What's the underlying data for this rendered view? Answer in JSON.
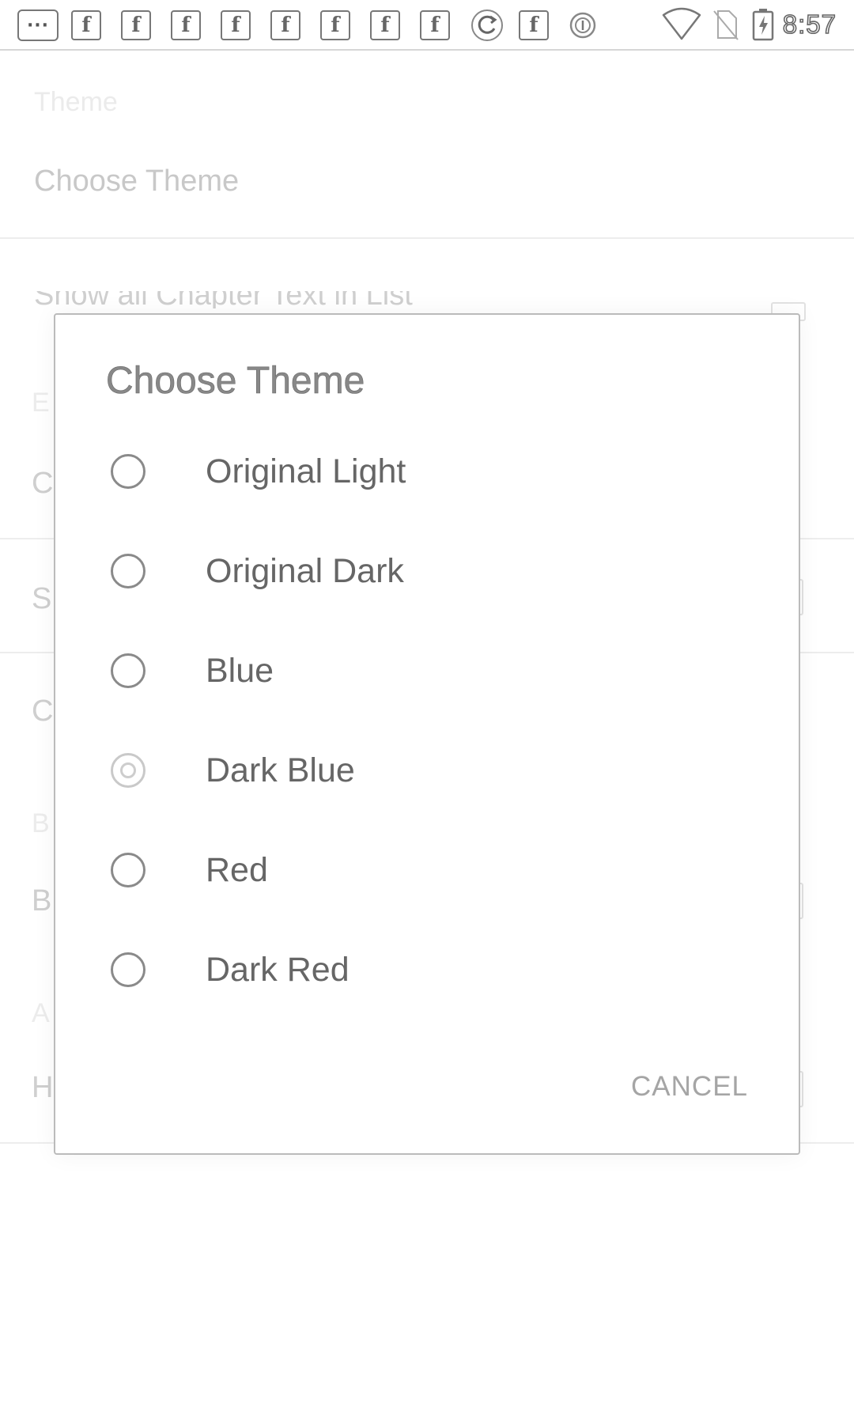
{
  "status_bar": {
    "time": "8:57",
    "left_icons": [
      "more-notifications-icon",
      "facebook-icon",
      "facebook-icon",
      "facebook-icon",
      "facebook-icon",
      "facebook-icon",
      "facebook-icon",
      "facebook-icon",
      "facebook-icon",
      "sync-icon",
      "facebook-icon",
      "circle-info-icon"
    ],
    "right_icons": [
      "wifi-icon",
      "no-sim-icon",
      "battery-charging-icon"
    ],
    "fb_glyph": "f",
    "more_glyph": "···"
  },
  "background": {
    "theme_category": "Theme",
    "theme_pref_title": "Choose Theme",
    "partial_row_text": "Show all Chapter Text in List",
    "stubs": [
      "E",
      "C",
      "S",
      "C",
      "B",
      "B",
      "A",
      "H"
    ]
  },
  "dialog": {
    "title": "Choose Theme",
    "options": [
      {
        "label": "Original Light",
        "selected": false
      },
      {
        "label": "Original Dark",
        "selected": false
      },
      {
        "label": "Blue",
        "selected": false
      },
      {
        "label": "Dark Blue",
        "selected": true
      },
      {
        "label": "Red",
        "selected": false
      },
      {
        "label": "Dark Red",
        "selected": false
      }
    ],
    "cancel_label": "CANCEL"
  }
}
